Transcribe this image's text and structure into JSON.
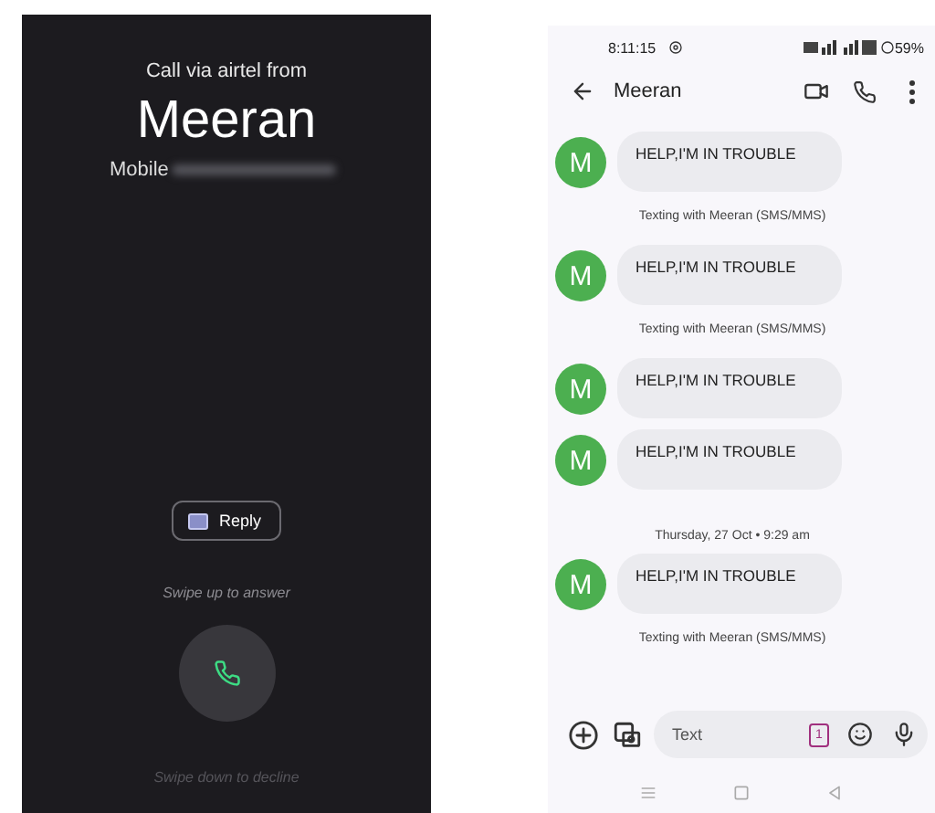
{
  "incoming_call": {
    "via": "Call via airtel from",
    "caller": "Meeran",
    "number_label": "Mobile",
    "reply_button": "Reply",
    "answer_hint": "Swipe up to answer",
    "decline_hint": "Swipe down to decline"
  },
  "messages_screen": {
    "status_bar": {
      "time": "8:11:15",
      "battery": "59%"
    },
    "header": {
      "title": "Meeran"
    },
    "thread": [
      {
        "kind": "message",
        "avatar": "M",
        "text": "HELP,I'M IN TROUBLE"
      },
      {
        "kind": "info",
        "text": "Texting with Meeran (SMS/MMS)"
      },
      {
        "kind": "message",
        "avatar": "M",
        "text": "HELP,I'M IN TROUBLE"
      },
      {
        "kind": "info",
        "text": "Texting with Meeran (SMS/MMS)"
      },
      {
        "kind": "message",
        "avatar": "M",
        "text": "HELP,I'M IN TROUBLE"
      },
      {
        "kind": "message",
        "avatar": "M",
        "text": "HELP,I'M IN TROUBLE"
      },
      {
        "kind": "date",
        "text": "Thursday, 27 Oct • 9:29 am"
      },
      {
        "kind": "message",
        "avatar": "M",
        "text": "HELP,I'M IN TROUBLE"
      },
      {
        "kind": "info",
        "text": "Texting with Meeran (SMS/MMS)"
      }
    ],
    "composer": {
      "placeholder": "Text",
      "sim": "1"
    }
  }
}
